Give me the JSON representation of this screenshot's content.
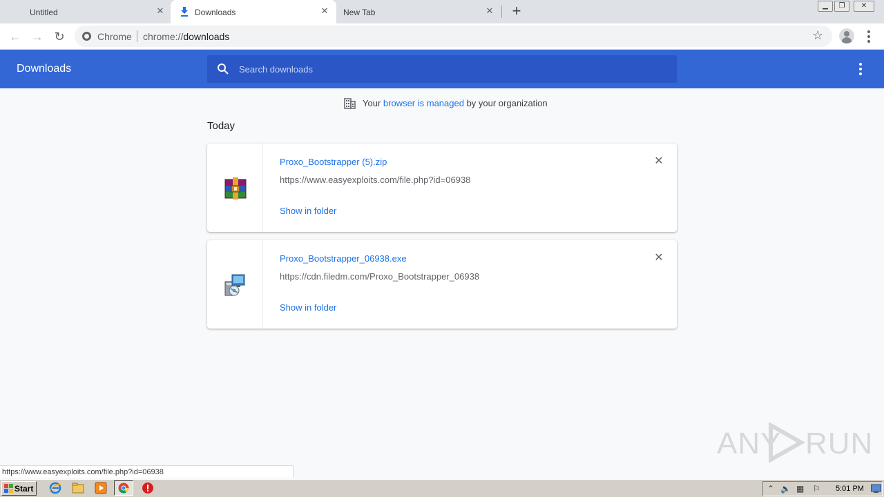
{
  "tabs": [
    {
      "title": "Untitled",
      "close": "✕",
      "active": false
    },
    {
      "title": "Downloads",
      "close": "✕",
      "active": true
    },
    {
      "title": "New Tab",
      "close": "✕",
      "active": false
    }
  ],
  "new_tab_glyph": "+",
  "toolbar": {
    "back": "←",
    "forward": "→",
    "reload": "↻",
    "origin_label": "Chrome",
    "url_scheme": "chrome://",
    "url_path": "downloads",
    "star": "☆"
  },
  "header": {
    "title": "Downloads",
    "search_placeholder": "Search downloads",
    "search_value": ""
  },
  "managed_notice": {
    "prefix": "Your ",
    "link": "browser is managed",
    "suffix": " by your organization"
  },
  "date_section": "Today",
  "downloads": [
    {
      "file_name": "Proxo_Bootstrapper (5).zip",
      "url": "https://www.easyexploits.com/file.php?id=06938",
      "action": "Show in folder",
      "remove": "✕",
      "icon": "winrar-archive-icon"
    },
    {
      "file_name": "Proxo_Bootstrapper_06938.exe",
      "url": "https://cdn.filedm.com/Proxo_Bootstrapper_06938",
      "action": "Show in folder",
      "remove": "✕",
      "icon": "installer-exe-icon"
    }
  ],
  "status_bar": "https://www.easyexploits.com/file.php?id=06938",
  "watermark": {
    "left": "ANY",
    "right": "RUN"
  },
  "taskbar": {
    "start_label": "Start",
    "clock": "5:01 PM",
    "icons": [
      "ie-icon",
      "explorer-icon",
      "media-player-icon",
      "chrome-icon",
      "stop-icon"
    ]
  },
  "colors": {
    "accent": "#3367d6",
    "search_bg": "#2a56c6",
    "link": "#1a73e8",
    "page_bg": "#f8f9fa"
  }
}
